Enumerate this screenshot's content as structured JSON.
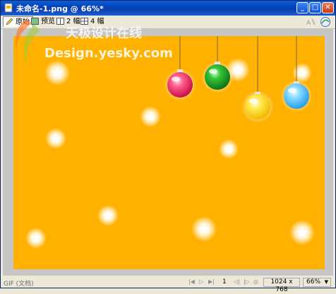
{
  "window": {
    "title": "未命名-1.png @ 66%*"
  },
  "tabs": [
    {
      "label": "原始",
      "icon": "pencil-icon"
    },
    {
      "label": "预览",
      "icon": "preview-icon"
    },
    {
      "label": "2 幅",
      "icon": "two-up-icon"
    },
    {
      "label": "4 幅",
      "icon": "four-up-icon"
    }
  ],
  "watermark": {
    "line1": "天极设计在线",
    "line2": "Design.yesky.com"
  },
  "status": {
    "format": "GIF (文档)",
    "page": "1",
    "dimensions": "1024 x 768",
    "zoom": "66%"
  },
  "colors": {
    "canvas": "#ffb100",
    "ornaments": [
      "#f0386a",
      "#1fae2b",
      "#f9e03a",
      "#4fc3f5"
    ]
  }
}
